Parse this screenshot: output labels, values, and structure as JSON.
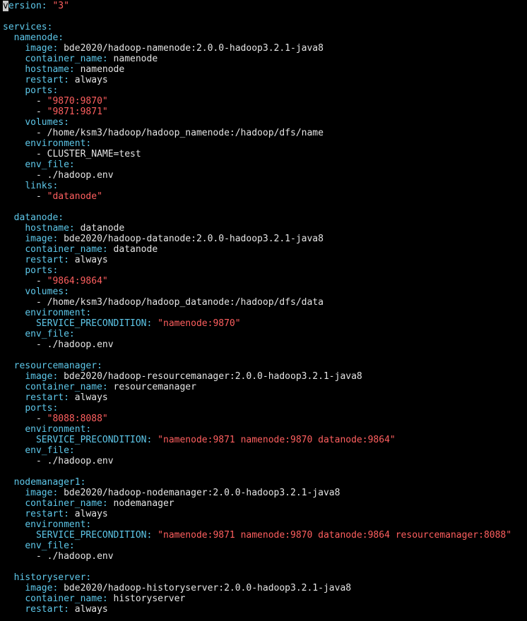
{
  "colors": {
    "background": "#000000",
    "key": "#5ec8ea",
    "string": "#ff5f5f",
    "plain": "#e4e4e4",
    "cursor": "#c8c8c8"
  },
  "cursor": {
    "line": 0,
    "char": "v"
  },
  "lines": [
    {
      "indent": "",
      "parts": [
        {
          "t": "cur",
          "v": "v"
        },
        {
          "t": "k",
          "v": "ersion:"
        },
        {
          "t": "v",
          "v": " "
        },
        {
          "t": "s",
          "v": "\"3\""
        }
      ]
    },
    {
      "indent": "",
      "parts": []
    },
    {
      "indent": "",
      "parts": [
        {
          "t": "k",
          "v": "services:"
        }
      ]
    },
    {
      "indent": "  ",
      "parts": [
        {
          "t": "k",
          "v": "namenode:"
        }
      ]
    },
    {
      "indent": "    ",
      "parts": [
        {
          "t": "k",
          "v": "image:"
        },
        {
          "t": "v",
          "v": " bde2020/hadoop-namenode:2.0.0-hadoop3.2.1-java8"
        }
      ]
    },
    {
      "indent": "    ",
      "parts": [
        {
          "t": "k",
          "v": "container_name:"
        },
        {
          "t": "v",
          "v": " namenode"
        }
      ]
    },
    {
      "indent": "    ",
      "parts": [
        {
          "t": "k",
          "v": "hostname:"
        },
        {
          "t": "v",
          "v": " namenode"
        }
      ]
    },
    {
      "indent": "    ",
      "parts": [
        {
          "t": "k",
          "v": "restart:"
        },
        {
          "t": "v",
          "v": " always"
        }
      ]
    },
    {
      "indent": "    ",
      "parts": [
        {
          "t": "k",
          "v": "ports:"
        }
      ]
    },
    {
      "indent": "      ",
      "parts": [
        {
          "t": "d",
          "v": "- "
        },
        {
          "t": "s",
          "v": "\"9870:9870\""
        }
      ]
    },
    {
      "indent": "      ",
      "parts": [
        {
          "t": "d",
          "v": "- "
        },
        {
          "t": "s",
          "v": "\"9871:9871\""
        }
      ]
    },
    {
      "indent": "    ",
      "parts": [
        {
          "t": "k",
          "v": "volumes:"
        }
      ]
    },
    {
      "indent": "      ",
      "parts": [
        {
          "t": "d",
          "v": "- "
        },
        {
          "t": "v",
          "v": "/home/ksm3/hadoop/hadoop_namenode:/hadoop/dfs/name"
        }
      ]
    },
    {
      "indent": "    ",
      "parts": [
        {
          "t": "k",
          "v": "environment:"
        }
      ]
    },
    {
      "indent": "      ",
      "parts": [
        {
          "t": "d",
          "v": "- "
        },
        {
          "t": "v",
          "v": "CLUSTER_NAME=test"
        }
      ]
    },
    {
      "indent": "    ",
      "parts": [
        {
          "t": "k",
          "v": "env_file:"
        }
      ]
    },
    {
      "indent": "      ",
      "parts": [
        {
          "t": "d",
          "v": "- "
        },
        {
          "t": "v",
          "v": "./hadoop.env"
        }
      ]
    },
    {
      "indent": "    ",
      "parts": [
        {
          "t": "k",
          "v": "links:"
        }
      ]
    },
    {
      "indent": "      ",
      "parts": [
        {
          "t": "d",
          "v": "- "
        },
        {
          "t": "s",
          "v": "\"datanode\""
        }
      ]
    },
    {
      "indent": "",
      "parts": []
    },
    {
      "indent": "  ",
      "parts": [
        {
          "t": "k",
          "v": "datanode:"
        }
      ]
    },
    {
      "indent": "    ",
      "parts": [
        {
          "t": "k",
          "v": "hostname:"
        },
        {
          "t": "v",
          "v": " datanode"
        }
      ]
    },
    {
      "indent": "    ",
      "parts": [
        {
          "t": "k",
          "v": "image:"
        },
        {
          "t": "v",
          "v": " bde2020/hadoop-datanode:2.0.0-hadoop3.2.1-java8"
        }
      ]
    },
    {
      "indent": "    ",
      "parts": [
        {
          "t": "k",
          "v": "container_name:"
        },
        {
          "t": "v",
          "v": " datanode"
        }
      ]
    },
    {
      "indent": "    ",
      "parts": [
        {
          "t": "k",
          "v": "restart:"
        },
        {
          "t": "v",
          "v": " always"
        }
      ]
    },
    {
      "indent": "    ",
      "parts": [
        {
          "t": "k",
          "v": "ports:"
        }
      ]
    },
    {
      "indent": "      ",
      "parts": [
        {
          "t": "d",
          "v": "- "
        },
        {
          "t": "s",
          "v": "\"9864:9864\""
        }
      ]
    },
    {
      "indent": "    ",
      "parts": [
        {
          "t": "k",
          "v": "volumes:"
        }
      ]
    },
    {
      "indent": "      ",
      "parts": [
        {
          "t": "d",
          "v": "- "
        },
        {
          "t": "v",
          "v": "/home/ksm3/hadoop/hadoop_datanode:/hadoop/dfs/data"
        }
      ]
    },
    {
      "indent": "    ",
      "parts": [
        {
          "t": "k",
          "v": "environment:"
        }
      ]
    },
    {
      "indent": "      ",
      "parts": [
        {
          "t": "k",
          "v": "SERVICE_PRECONDITION:"
        },
        {
          "t": "v",
          "v": " "
        },
        {
          "t": "s",
          "v": "\"namenode:9870\""
        }
      ]
    },
    {
      "indent": "    ",
      "parts": [
        {
          "t": "k",
          "v": "env_file:"
        }
      ]
    },
    {
      "indent": "      ",
      "parts": [
        {
          "t": "d",
          "v": "- "
        },
        {
          "t": "v",
          "v": "./hadoop.env"
        }
      ]
    },
    {
      "indent": "",
      "parts": []
    },
    {
      "indent": "  ",
      "parts": [
        {
          "t": "k",
          "v": "resourcemanager:"
        }
      ]
    },
    {
      "indent": "    ",
      "parts": [
        {
          "t": "k",
          "v": "image:"
        },
        {
          "t": "v",
          "v": " bde2020/hadoop-resourcemanager:2.0.0-hadoop3.2.1-java8"
        }
      ]
    },
    {
      "indent": "    ",
      "parts": [
        {
          "t": "k",
          "v": "container_name:"
        },
        {
          "t": "v",
          "v": " resourcemanager"
        }
      ]
    },
    {
      "indent": "    ",
      "parts": [
        {
          "t": "k",
          "v": "restart:"
        },
        {
          "t": "v",
          "v": " always"
        }
      ]
    },
    {
      "indent": "    ",
      "parts": [
        {
          "t": "k",
          "v": "ports:"
        }
      ]
    },
    {
      "indent": "      ",
      "parts": [
        {
          "t": "d",
          "v": "- "
        },
        {
          "t": "s",
          "v": "\"8088:8088\""
        }
      ]
    },
    {
      "indent": "    ",
      "parts": [
        {
          "t": "k",
          "v": "environment:"
        }
      ]
    },
    {
      "indent": "      ",
      "parts": [
        {
          "t": "k",
          "v": "SERVICE_PRECONDITION:"
        },
        {
          "t": "v",
          "v": " "
        },
        {
          "t": "s",
          "v": "\"namenode:9871 namenode:9870 datanode:9864\""
        }
      ]
    },
    {
      "indent": "    ",
      "parts": [
        {
          "t": "k",
          "v": "env_file:"
        }
      ]
    },
    {
      "indent": "      ",
      "parts": [
        {
          "t": "d",
          "v": "- "
        },
        {
          "t": "v",
          "v": "./hadoop.env"
        }
      ]
    },
    {
      "indent": "",
      "parts": []
    },
    {
      "indent": "  ",
      "parts": [
        {
          "t": "k",
          "v": "nodemanager1:"
        }
      ]
    },
    {
      "indent": "    ",
      "parts": [
        {
          "t": "k",
          "v": "image:"
        },
        {
          "t": "v",
          "v": " bde2020/hadoop-nodemanager:2.0.0-hadoop3.2.1-java8"
        }
      ]
    },
    {
      "indent": "    ",
      "parts": [
        {
          "t": "k",
          "v": "container_name:"
        },
        {
          "t": "v",
          "v": " nodemanager"
        }
      ]
    },
    {
      "indent": "    ",
      "parts": [
        {
          "t": "k",
          "v": "restart:"
        },
        {
          "t": "v",
          "v": " always"
        }
      ]
    },
    {
      "indent": "    ",
      "parts": [
        {
          "t": "k",
          "v": "environment:"
        }
      ]
    },
    {
      "indent": "      ",
      "parts": [
        {
          "t": "k",
          "v": "SERVICE_PRECONDITION:"
        },
        {
          "t": "v",
          "v": " "
        },
        {
          "t": "s",
          "v": "\"namenode:9871 namenode:9870 datanode:9864 resourcemanager:8088\""
        }
      ]
    },
    {
      "indent": "    ",
      "parts": [
        {
          "t": "k",
          "v": "env_file:"
        }
      ]
    },
    {
      "indent": "      ",
      "parts": [
        {
          "t": "d",
          "v": "- "
        },
        {
          "t": "v",
          "v": "./hadoop.env"
        }
      ]
    },
    {
      "indent": "",
      "parts": []
    },
    {
      "indent": "  ",
      "parts": [
        {
          "t": "k",
          "v": "historyserver:"
        }
      ]
    },
    {
      "indent": "    ",
      "parts": [
        {
          "t": "k",
          "v": "image:"
        },
        {
          "t": "v",
          "v": " bde2020/hadoop-historyserver:2.0.0-hadoop3.2.1-java8"
        }
      ]
    },
    {
      "indent": "    ",
      "parts": [
        {
          "t": "k",
          "v": "container_name:"
        },
        {
          "t": "v",
          "v": " historyserver"
        }
      ]
    },
    {
      "indent": "    ",
      "parts": [
        {
          "t": "k",
          "v": "restart:"
        },
        {
          "t": "v",
          "v": " always"
        }
      ]
    }
  ]
}
